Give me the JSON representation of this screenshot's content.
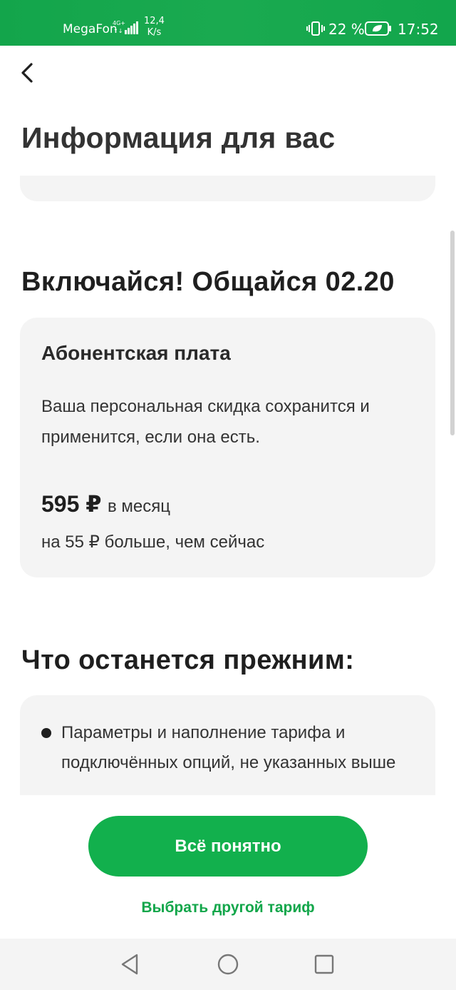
{
  "status_bar": {
    "carrier": "MegaFon",
    "network": "4G+",
    "speed_value": "12,4",
    "speed_unit": "K/s",
    "battery_percent": "22 %",
    "time": "17:52",
    "icons": [
      "signal-icon",
      "vibrate-icon",
      "battery-icon"
    ]
  },
  "header": {
    "back_icon": "chevron-left-icon",
    "title": "Информация для вас"
  },
  "tariff": {
    "name": "Включайся! Общайся 02.20",
    "fee_card": {
      "heading": "Абонентская плата",
      "text": "Ваша персональная скидка сохранится и применится, если она есть.",
      "price": "595 ₽",
      "price_unit": "в месяц",
      "difference": "на 55 ₽ больше, чем сейчас"
    }
  },
  "unchanged": {
    "title": "Что останется прежним:",
    "items": [
      "Параметры и наполнение тарифа и подключённых опций, не указанных выше"
    ]
  },
  "actions": {
    "confirm_label": "Всё понятно",
    "other_tariff_label": "Выбрать другой тариф"
  },
  "nav_bar": {
    "buttons": [
      "back-triangle-icon",
      "home-circle-icon",
      "recents-square-icon"
    ]
  },
  "colors": {
    "brand_green": "#12b04d",
    "status_bar_green": "#1aaa50",
    "card_background": "#f4f4f4",
    "link_green": "#12a64a"
  }
}
